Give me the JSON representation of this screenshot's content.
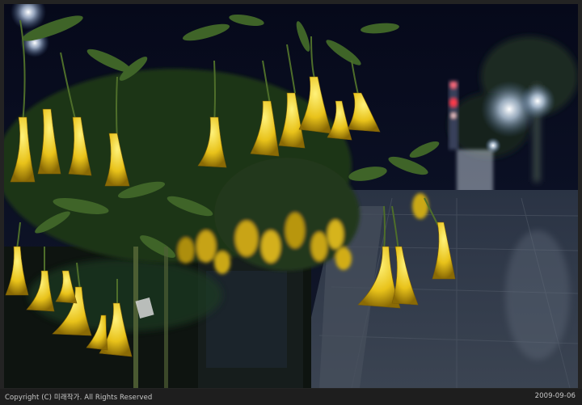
{
  "photo": {
    "subject": "yellow angel's trumpet flowers at night beside a paved path"
  },
  "caption": {
    "copyright": "Copyright (C) 미래작가. All Rights Reserved",
    "date": "2009-09-06"
  }
}
